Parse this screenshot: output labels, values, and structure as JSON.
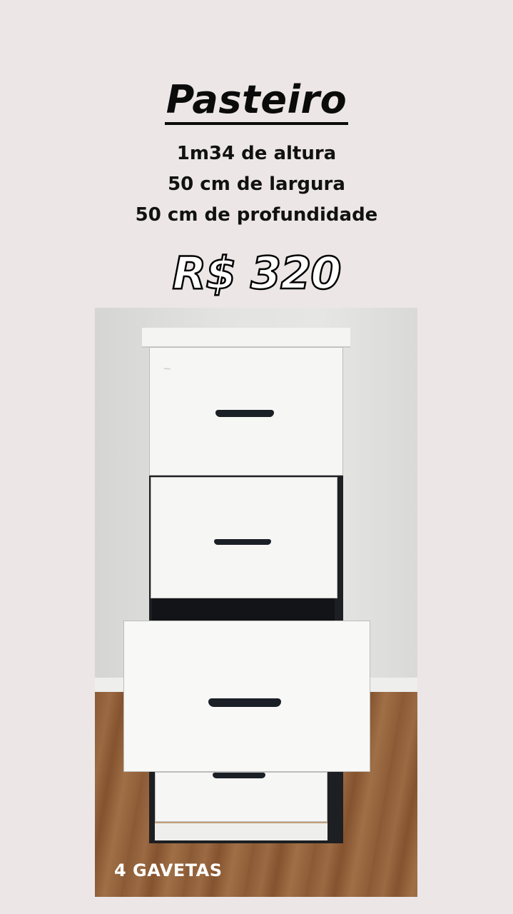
{
  "title": "Pasteiro",
  "specs": {
    "height": "1m34 de altura",
    "width": "50 cm de largura",
    "depth": "50 cm de profundidade"
  },
  "price": "R$ 320",
  "caption": "4 GAVETAS",
  "colors": {
    "background": "#ece6e6",
    "title": "#0b0b0b",
    "price_fill": "#ffffff",
    "price_stroke": "#000000"
  }
}
